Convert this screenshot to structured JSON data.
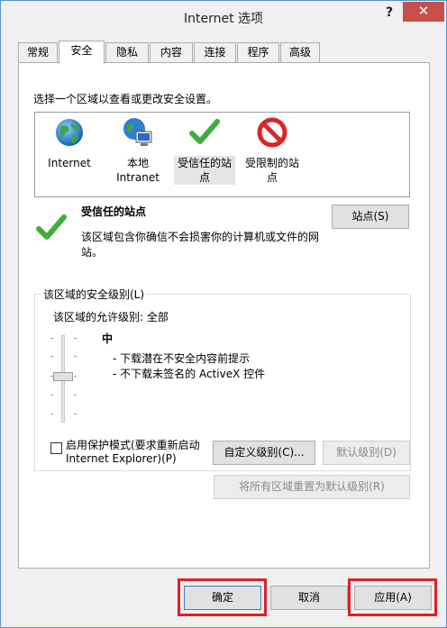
{
  "window": {
    "title": "Internet 选项",
    "help": "?",
    "close": "✕"
  },
  "tabs": [
    "常规",
    "安全",
    "隐私",
    "内容",
    "连接",
    "程序",
    "高级"
  ],
  "security": {
    "instruction": "选择一个区域以查看或更改安全设置。",
    "zones": [
      {
        "line1": "Internet",
        "line2": "",
        "icon": "globe-icon"
      },
      {
        "line1": "本地",
        "line2": "Intranet",
        "icon": "intranet-icon"
      },
      {
        "line1": "受信任的站",
        "line2": "点",
        "icon": "checkmark-icon"
      },
      {
        "line1": "受限制的站",
        "line2": "点",
        "icon": "restricted-icon"
      }
    ],
    "selected_zone_title": "受信任的站点",
    "selected_zone_desc_line1": "该区域包含你确信不会损害你的计算机或文件的网",
    "selected_zone_desc_line2": "站。",
    "sites_button": "站点(S)",
    "level_group_title": "该区域的安全级别(L)",
    "allowed_levels": "该区域的允许级别: 全部",
    "level_name": "中",
    "level_desc_1": "- 下载潜在不安全内容前提示",
    "level_desc_2": "- 不下载未签名的 ActiveX 控件",
    "protected_mode_line1": "启用保护模式(要求重新启动",
    "protected_mode_line2": "Internet Explorer)(P)",
    "protected_mode_checked": false,
    "custom_level_button": "自定义级别(C)...",
    "default_level_button": "默认级别(D)",
    "reset_all_button": "将所有区域重置为默认级别(R)"
  },
  "footer": {
    "ok": "确定",
    "cancel": "取消",
    "apply": "应用(A)"
  },
  "colors": {
    "highlight": "#e02027",
    "close": "#c7504a",
    "check": "#3fae3a",
    "restricted": "#d9262b"
  }
}
